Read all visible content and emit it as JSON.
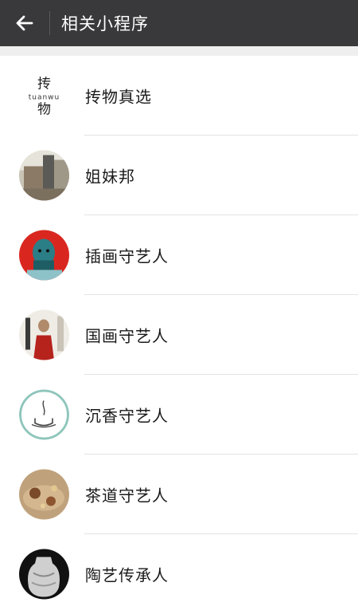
{
  "header": {
    "title": "相关小程序",
    "back_icon": "arrow-left-icon"
  },
  "list": {
    "items": [
      {
        "label": "抟物真选",
        "logo_text_top": "抟",
        "logo_text_mid": "tuanwu",
        "logo_text_bottom": "物"
      },
      {
        "label": "姐妹邦"
      },
      {
        "label": "插画守艺人"
      },
      {
        "label": "国画守艺人"
      },
      {
        "label": "沉香守艺人"
      },
      {
        "label": "茶道守艺人"
      },
      {
        "label": "陶艺传承人"
      }
    ]
  },
  "colors": {
    "header_bg": "#39393b",
    "list_bg": "#ffffff",
    "page_bg": "#f2f2f2"
  }
}
